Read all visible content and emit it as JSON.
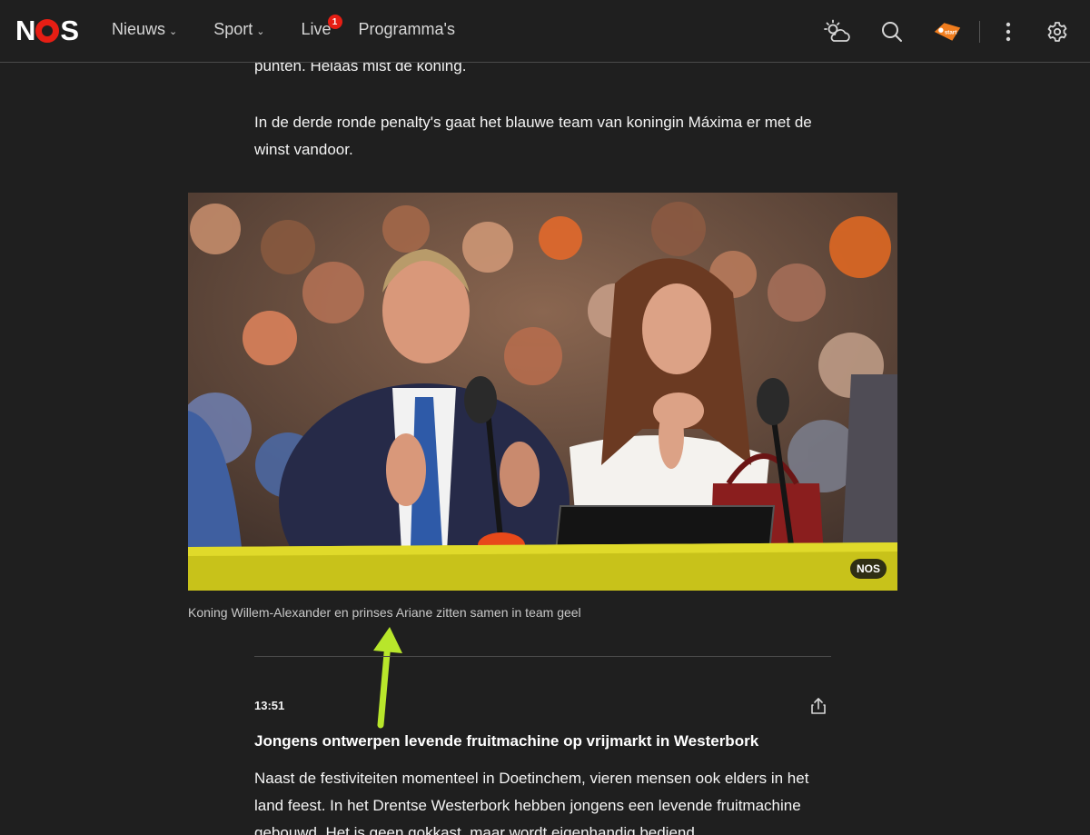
{
  "header": {
    "logo_text": "NOS",
    "nav": [
      {
        "label": "Nieuws",
        "chevron": "⌄"
      },
      {
        "label": "Sport",
        "chevron": "⌄"
      },
      {
        "label": "Live",
        "badge": "1"
      },
      {
        "label": "Programma's"
      }
    ],
    "icons": [
      "weather-icon",
      "search-icon",
      "npo-start-icon",
      "more-vertical-icon",
      "settings-icon"
    ],
    "npo_label": "start"
  },
  "article": {
    "para_top": "punten. Helaas mist de koning.",
    "para_1": "In de derde ronde penalty's gaat het blauwe team van koningin Máxima er met de winst vandoor.",
    "photo_badge": "NOS",
    "caption": "Koning Willem-Alexander en prinses Ariane zitten samen in team geel",
    "post": {
      "time": "13:51",
      "headline": "Jongens ontwerpen levende fruitmachine op vrijmarkt in Westerbork",
      "body": "Naast de festiviteiten momenteel in Doetinchem, vieren mensen ook elders in het land feest. In het Drentse Westerbork hebben jongens een levende fruitmachine gebouwd. Het is geen gokkast, maar wordt eigenhandig bediend"
    }
  },
  "colors": {
    "background": "#1f1f1f",
    "brand_red": "#e61e14",
    "annotation_arrow": "#b8e62b"
  }
}
